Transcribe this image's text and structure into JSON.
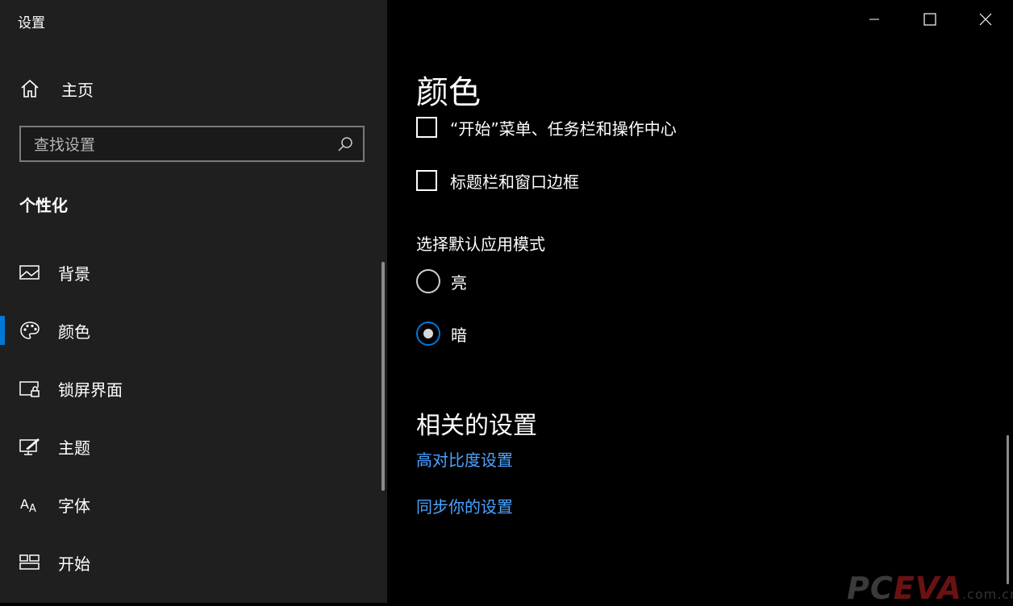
{
  "app": {
    "title": "设置"
  },
  "sidebar": {
    "home_label": "主页",
    "search_placeholder": "查找设置",
    "section_title": "个性化",
    "items": [
      {
        "label": "背景",
        "icon": "picture-icon"
      },
      {
        "label": "颜色",
        "icon": "palette-icon",
        "selected": true
      },
      {
        "label": "锁屏界面",
        "icon": "lock-screen-icon"
      },
      {
        "label": "主题",
        "icon": "theme-icon"
      },
      {
        "label": "字体",
        "icon": "font-icon"
      },
      {
        "label": "开始",
        "icon": "start-icon"
      }
    ]
  },
  "main": {
    "title": "颜色",
    "checkboxes": [
      {
        "label": "“开始”菜单、任务栏和操作中心",
        "checked": false
      },
      {
        "label": "标题栏和窗口边框",
        "checked": false
      }
    ],
    "mode_heading": "选择默认应用模式",
    "modes": [
      {
        "label": "亮",
        "checked": false
      },
      {
        "label": "暗",
        "checked": true
      }
    ],
    "related_title": "相关的设置",
    "links": [
      {
        "label": "高对比度设置"
      },
      {
        "label": "同步你的设置"
      }
    ]
  },
  "watermark": {
    "brand_a": "PC",
    "brand_b": "EVA",
    "domain": ".com.cn"
  },
  "colors": {
    "accent": "#0078d7",
    "link": "#4aa3ff",
    "sidebar_bg": "#1f1f1f",
    "main_bg": "#000000"
  }
}
